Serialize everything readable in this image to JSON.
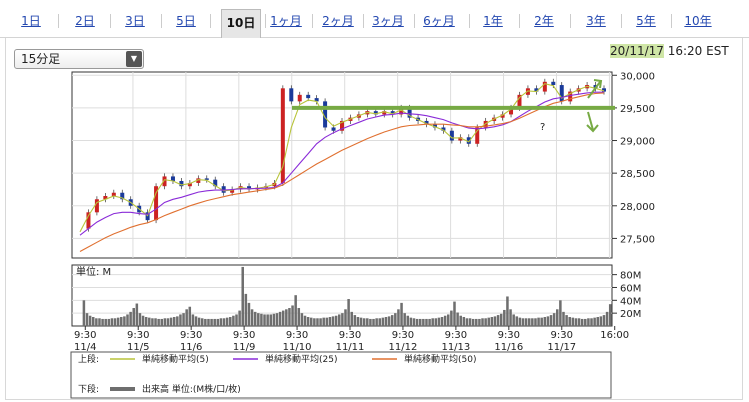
{
  "tabs": [
    {
      "label": "1日",
      "active": false
    },
    {
      "label": "2日",
      "active": false
    },
    {
      "label": "3日",
      "active": false
    },
    {
      "label": "5日",
      "active": false
    },
    {
      "label": "10日",
      "active": true
    },
    {
      "label": "1ヶ月",
      "active": false
    },
    {
      "label": "2ヶ月",
      "active": false
    },
    {
      "label": "3ヶ月",
      "active": false
    },
    {
      "label": "6ヶ月",
      "active": false
    },
    {
      "label": "1年",
      "active": false
    },
    {
      "label": "2年",
      "active": false
    },
    {
      "label": "3年",
      "active": false
    },
    {
      "label": "5年",
      "active": false
    },
    {
      "label": "10年",
      "active": false
    }
  ],
  "period_select": {
    "value": "15分足"
  },
  "timestamp": {
    "date": "20/11/17",
    "time": "16:20 EST"
  },
  "annotation": {
    "question_mark": "?"
  },
  "colors": {
    "ma5": "#b8c43a",
    "ma25": "#8a2bd8",
    "ma50": "#e07030",
    "up": "#cc2222",
    "down": "#1a3a9a",
    "volume": "#6e6e6e",
    "annotation": "#77aa44"
  },
  "chart_data": [
    {
      "type": "line",
      "ylim": [
        27200,
        30050
      ],
      "y_ticks": [
        27500,
        28000,
        28500,
        29000,
        29500,
        30000
      ],
      "y_tick_labels": [
        "27,500",
        "28,000",
        "28,500",
        "29,000",
        "29,500",
        "30,000"
      ],
      "sessions": [
        "11/4",
        "11/5",
        "11/6",
        "11/9",
        "11/10",
        "11/11",
        "11/12",
        "11/13",
        "11/16",
        "11/17"
      ],
      "x_tick_labels": [
        [
          "9:30",
          "11/4"
        ],
        [
          "9:30",
          "11/5"
        ],
        [
          "9:30",
          "11/6"
        ],
        [
          "9:30",
          "11/9"
        ],
        [
          "9:30",
          "11/10"
        ],
        [
          "9:30",
          "11/11"
        ],
        [
          "9:30",
          "11/12"
        ],
        [
          "9:30",
          "11/13"
        ],
        [
          "9:30",
          "11/16"
        ],
        [
          "9:30",
          "11/17"
        ],
        [
          "16:00",
          ""
        ]
      ],
      "price": [
        27650,
        27900,
        28100,
        28150,
        28200,
        28100,
        28000,
        27900,
        27780,
        28300,
        28450,
        28380,
        28300,
        28350,
        28420,
        28400,
        28300,
        28200,
        28250,
        28300,
        28250,
        28280,
        28300,
        28350,
        29800,
        29600,
        29700,
        29650,
        29600,
        29200,
        29150,
        29300,
        29350,
        29400,
        29450,
        29400,
        29450,
        29400,
        29500,
        29350,
        29300,
        29250,
        29200,
        29150,
        29000,
        29050,
        28950,
        29200,
        29300,
        29350,
        29400,
        29500,
        29700,
        29800,
        29750,
        29900,
        29850,
        29600,
        29750,
        29800,
        29850,
        29800,
        29750
      ],
      "series": [
        {
          "name": "単純移動平均(5)",
          "values": [
            27600,
            27850,
            28050,
            28100,
            28150,
            28120,
            28050,
            27950,
            27850,
            28200,
            28400,
            28380,
            28320,
            28340,
            28400,
            28390,
            28310,
            28230,
            28240,
            28280,
            28260,
            28270,
            28290,
            28330,
            28600,
            29200,
            29550,
            29620,
            29600,
            29350,
            29220,
            29280,
            29330,
            29380,
            29430,
            29410,
            29440,
            29410,
            29470,
            29380,
            29320,
            29260,
            29210,
            29160,
            29040,
            29040,
            28980,
            29150,
            29260,
            29330,
            29390,
            29480,
            29660,
            29760,
            29750,
            29870,
            29840,
            29650,
            29720,
            29780,
            29830,
            29800,
            29760
          ]
        },
        {
          "name": "単純移動平均(25)",
          "values": [
            27550,
            27650,
            27750,
            27820,
            27880,
            27900,
            27900,
            27880,
            27870,
            27950,
            28050,
            28100,
            28130,
            28170,
            28210,
            28230,
            28240,
            28240,
            28250,
            28260,
            28260,
            28265,
            28270,
            28280,
            28350,
            28500,
            28650,
            28800,
            28950,
            29050,
            29120,
            29180,
            29230,
            29280,
            29330,
            29360,
            29390,
            29400,
            29420,
            29410,
            29400,
            29380,
            29350,
            29320,
            29270,
            29230,
            29190,
            29180,
            29190,
            29210,
            29240,
            29290,
            29370,
            29450,
            29520,
            29590,
            29640,
            29660,
            29690,
            29710,
            29730,
            29740,
            29740
          ]
        },
        {
          "name": "単純移動平均(50)",
          "values": [
            27300,
            27370,
            27440,
            27510,
            27570,
            27620,
            27670,
            27710,
            27740,
            27790,
            27850,
            27900,
            27950,
            28000,
            28040,
            28080,
            28110,
            28140,
            28170,
            28190,
            28210,
            28230,
            28250,
            28270,
            28320,
            28400,
            28480,
            28560,
            28640,
            28710,
            28780,
            28850,
            28910,
            28970,
            29030,
            29080,
            29130,
            29170,
            29210,
            29230,
            29240,
            29250,
            29250,
            29250,
            29240,
            29230,
            29210,
            29210,
            29220,
            29240,
            29260,
            29290,
            29340,
            29400,
            29460,
            29520,
            29570,
            29600,
            29640,
            29670,
            29700,
            29720,
            29730
          ]
        }
      ],
      "ma_labels": {
        "prefix": "上段:",
        "ma5": "単純移動平均(5)",
        "ma25": "単純移動平均(25)",
        "ma50": "単純移動平均(50)"
      }
    },
    {
      "type": "bar",
      "unit_label": "単位: M",
      "ylim": [
        0,
        95
      ],
      "y_ticks": [
        20,
        40,
        60,
        80
      ],
      "y_tick_labels": [
        "20M",
        "40M",
        "60M",
        "80M"
      ],
      "sessions": [
        "11/4",
        "11/5",
        "11/6",
        "11/9",
        "11/10",
        "11/11",
        "11/12",
        "11/13",
        "11/16",
        "11/17"
      ],
      "values": [
        [
          40,
          20,
          16,
          14,
          12,
          12,
          11,
          11,
          11,
          12,
          12,
          13,
          14,
          15,
          18,
          22,
          28
        ],
        [
          35,
          20,
          16,
          14,
          13,
          12,
          12,
          11,
          11,
          12,
          12,
          13,
          14,
          15,
          18,
          20,
          26
        ],
        [
          30,
          18,
          15,
          13,
          12,
          11,
          11,
          11,
          11,
          11,
          12,
          12,
          13,
          14,
          16,
          18,
          24
        ],
        [
          92,
          50,
          36,
          26,
          22,
          20,
          19,
          18,
          18,
          18,
          19,
          20,
          22,
          24,
          26,
          28,
          32
        ],
        [
          48,
          28,
          20,
          16,
          14,
          13,
          12,
          12,
          12,
          13,
          13,
          14,
          15,
          16,
          18,
          20,
          26
        ],
        [
          42,
          22,
          17,
          14,
          13,
          12,
          12,
          11,
          11,
          12,
          12,
          13,
          14,
          15,
          17,
          20,
          26
        ],
        [
          36,
          20,
          16,
          13,
          12,
          11,
          11,
          11,
          11,
          11,
          12,
          12,
          13,
          14,
          16,
          18,
          24
        ],
        [
          38,
          21,
          16,
          14,
          12,
          12,
          11,
          11,
          11,
          12,
          12,
          13,
          14,
          15,
          17,
          19,
          25
        ],
        [
          46,
          26,
          18,
          15,
          13,
          12,
          12,
          12,
          12,
          12,
          13,
          13,
          14,
          15,
          17,
          20,
          26
        ],
        [
          40,
          22,
          17,
          14,
          13,
          12,
          12,
          11,
          11,
          12,
          12,
          13,
          14,
          15,
          17,
          22,
          34
        ]
      ],
      "volume_label": {
        "prefix": "下段:",
        "name": "出来高 単位:(M株/口/枚)"
      }
    }
  ]
}
